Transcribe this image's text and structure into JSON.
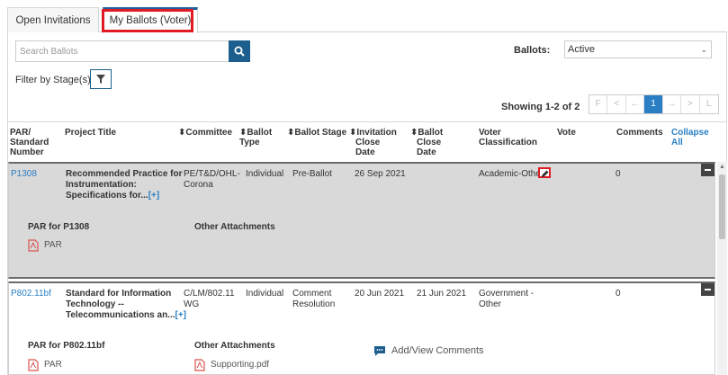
{
  "tabs": [
    {
      "label": "Open Invitations"
    },
    {
      "label": "My Ballots (Voter)"
    }
  ],
  "search": {
    "placeholder": "Search Ballots"
  },
  "ballots_filter": {
    "label": "Ballots:",
    "selected": "Active"
  },
  "stage_filter": {
    "label": "Filter by Stage(s)"
  },
  "pagination": {
    "showing": "Showing 1-2 of 2",
    "buttons": [
      "F",
      "<",
      "←",
      "1",
      "→",
      ">",
      "L"
    ]
  },
  "columns": {
    "par": [
      "PAR/",
      "Standard",
      "Number"
    ],
    "title": "Project Title",
    "committee": "⬍Committee",
    "ballot_type": [
      "⬍Ballot",
      "Type"
    ],
    "ballot_stage": "⬍Ballot Stage",
    "invitation_close": [
      "⬍Invitation",
      "Close",
      "Date"
    ],
    "ballot_close": [
      "⬍Ballot",
      "Close",
      "Date"
    ],
    "voter_class": [
      "Voter",
      "Classification"
    ],
    "vote": "Vote",
    "comments": "Comments",
    "collapse": [
      "Collapse",
      "All"
    ]
  },
  "rows": [
    {
      "par": "P1308",
      "title": [
        "Recommended Practice for",
        "Instrumentation:",
        "Specifications for..."
      ],
      "more": "[+]",
      "committee": [
        "PE/T&D/OHL-",
        "Corona"
      ],
      "ballot_type": "Individual",
      "ballot_stage": "Pre-Ballot",
      "invitation_close": "26 Sep 2021",
      "ballot_close": "",
      "voter_class": "Academic-Other",
      "vote": "",
      "comments": "0",
      "par_section": "PAR for P1308",
      "attachments_section": "Other Attachments",
      "par_file": "PAR"
    },
    {
      "par": "P802.11bf",
      "title": [
        "Standard for Information",
        "Technology --",
        "Telecommunications an..."
      ],
      "more": "[+]",
      "committee": [
        "C/LM/802.11",
        "WG"
      ],
      "ballot_type": "Individual",
      "ballot_stage": [
        "Comment",
        "Resolution"
      ],
      "invitation_close": "20 Jun 2021",
      "ballot_close": "21 Jun 2021",
      "voter_class": [
        "Government -",
        "Other"
      ],
      "vote": "",
      "comments": "0",
      "par_section": "PAR for P802.11bf",
      "attachments_section": "Other Attachments",
      "par_file": "PAR",
      "attachment_file": "Supporting.pdf",
      "comments_link": "Add/View Comments"
    }
  ],
  "colors": {
    "accent": "#1c5e8e",
    "link": "#2a7fc4",
    "highlight": "#e01b24",
    "pdf": "#d9534f"
  }
}
